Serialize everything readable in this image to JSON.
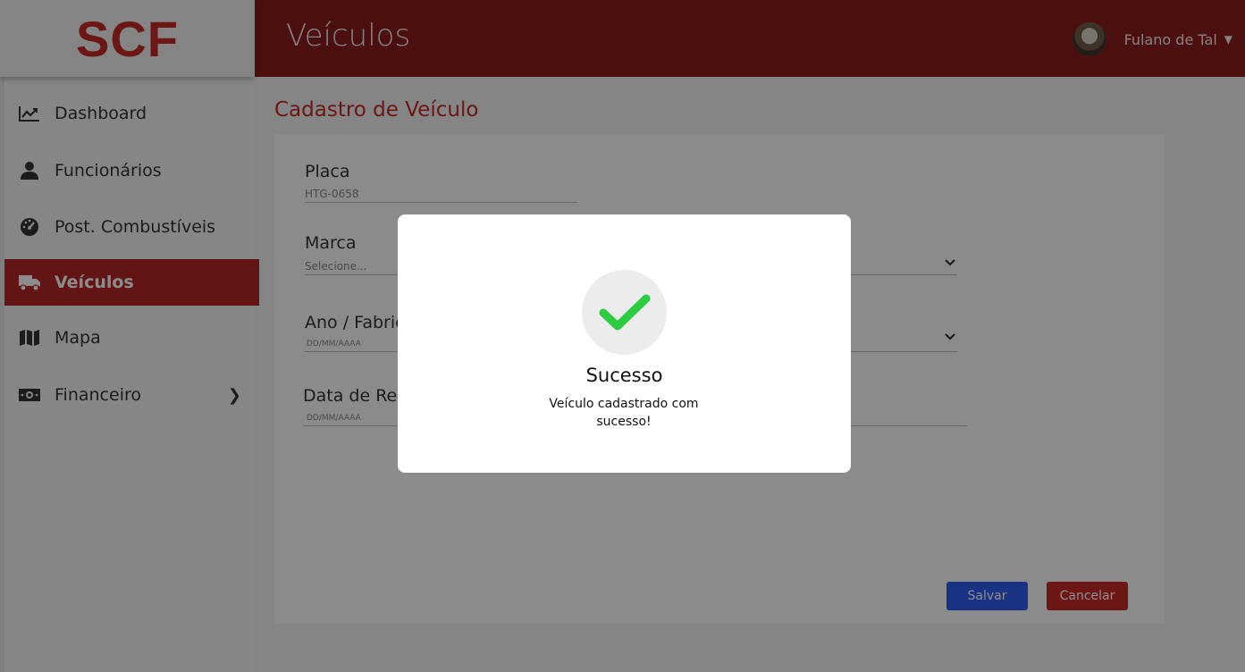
{
  "app": {
    "logo": "SCF",
    "page_title": "Veículos"
  },
  "user": {
    "name": "Fulano de Tal",
    "caret": "▼"
  },
  "sidebar": {
    "items": [
      {
        "label": "Dashboard",
        "icon": "chart-line-icon"
      },
      {
        "label": "Funcionários",
        "icon": "user-icon"
      },
      {
        "label": "Post. Combustíveis",
        "icon": "gauge-icon"
      },
      {
        "label": "Veículos",
        "icon": "truck-icon",
        "active": true
      },
      {
        "label": "Mapa",
        "icon": "map-icon"
      },
      {
        "label": "Financeiro",
        "icon": "money-icon",
        "chevron": "❯"
      }
    ]
  },
  "form": {
    "title": "Cadastro de Veículo",
    "placa": {
      "label": "Placa",
      "value": "HTG-0658"
    },
    "marca": {
      "label": "Marca",
      "placeholder": "Selecione..."
    },
    "ano": {
      "label": "Ano / Fabric",
      "placeholder": "DD/MM/AAAA"
    },
    "data": {
      "label": "Data de Req",
      "placeholder": "DD/MM/AAAA"
    },
    "save_label": "Salvar",
    "cancel_label": "Cancelar"
  },
  "modal": {
    "title": "Sucesso",
    "message": "Veículo cadastrado com sucesso!",
    "icon": "check-icon",
    "check_color": "#2ecc40"
  }
}
